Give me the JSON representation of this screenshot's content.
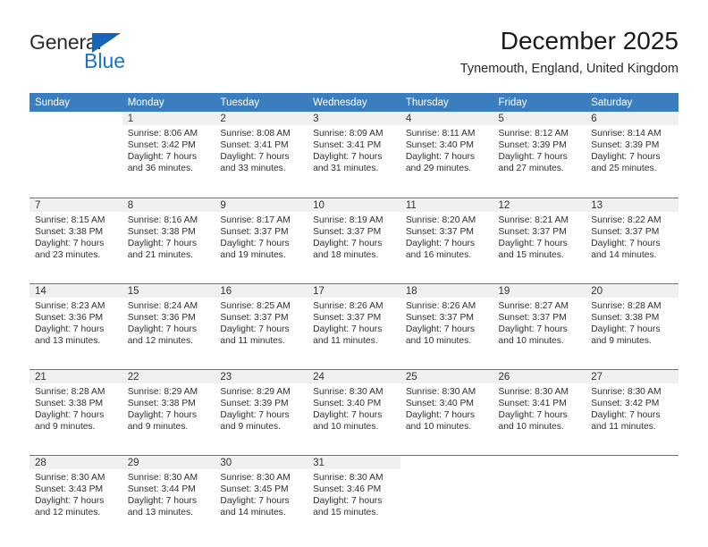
{
  "brand": {
    "name_top": "General",
    "name_bottom": "Blue",
    "accent_color": "#1874c8",
    "triangle_color": "#1565b8"
  },
  "header": {
    "title": "December 2025",
    "subtitle": "Tynemouth, England, United Kingdom"
  },
  "calendar": {
    "header_bg": "#3a7ebf",
    "header_text_color": "#ffffff",
    "daynum_bg": "#f0f0f0",
    "weekdays": [
      "Sunday",
      "Monday",
      "Tuesday",
      "Wednesday",
      "Thursday",
      "Friday",
      "Saturday"
    ],
    "weeks": [
      [
        {
          "day": "",
          "sunrise": "",
          "sunset": "",
          "daylight_line1": "",
          "daylight_line2": ""
        },
        {
          "day": "1",
          "sunrise": "Sunrise: 8:06 AM",
          "sunset": "Sunset: 3:42 PM",
          "daylight_line1": "Daylight: 7 hours",
          "daylight_line2": "and 36 minutes."
        },
        {
          "day": "2",
          "sunrise": "Sunrise: 8:08 AM",
          "sunset": "Sunset: 3:41 PM",
          "daylight_line1": "Daylight: 7 hours",
          "daylight_line2": "and 33 minutes."
        },
        {
          "day": "3",
          "sunrise": "Sunrise: 8:09 AM",
          "sunset": "Sunset: 3:41 PM",
          "daylight_line1": "Daylight: 7 hours",
          "daylight_line2": "and 31 minutes."
        },
        {
          "day": "4",
          "sunrise": "Sunrise: 8:11 AM",
          "sunset": "Sunset: 3:40 PM",
          "daylight_line1": "Daylight: 7 hours",
          "daylight_line2": "and 29 minutes."
        },
        {
          "day": "5",
          "sunrise": "Sunrise: 8:12 AM",
          "sunset": "Sunset: 3:39 PM",
          "daylight_line1": "Daylight: 7 hours",
          "daylight_line2": "and 27 minutes."
        },
        {
          "day": "6",
          "sunrise": "Sunrise: 8:14 AM",
          "sunset": "Sunset: 3:39 PM",
          "daylight_line1": "Daylight: 7 hours",
          "daylight_line2": "and 25 minutes."
        }
      ],
      [
        {
          "day": "7",
          "sunrise": "Sunrise: 8:15 AM",
          "sunset": "Sunset: 3:38 PM",
          "daylight_line1": "Daylight: 7 hours",
          "daylight_line2": "and 23 minutes."
        },
        {
          "day": "8",
          "sunrise": "Sunrise: 8:16 AM",
          "sunset": "Sunset: 3:38 PM",
          "daylight_line1": "Daylight: 7 hours",
          "daylight_line2": "and 21 minutes."
        },
        {
          "day": "9",
          "sunrise": "Sunrise: 8:17 AM",
          "sunset": "Sunset: 3:37 PM",
          "daylight_line1": "Daylight: 7 hours",
          "daylight_line2": "and 19 minutes."
        },
        {
          "day": "10",
          "sunrise": "Sunrise: 8:19 AM",
          "sunset": "Sunset: 3:37 PM",
          "daylight_line1": "Daylight: 7 hours",
          "daylight_line2": "and 18 minutes."
        },
        {
          "day": "11",
          "sunrise": "Sunrise: 8:20 AM",
          "sunset": "Sunset: 3:37 PM",
          "daylight_line1": "Daylight: 7 hours",
          "daylight_line2": "and 16 minutes."
        },
        {
          "day": "12",
          "sunrise": "Sunrise: 8:21 AM",
          "sunset": "Sunset: 3:37 PM",
          "daylight_line1": "Daylight: 7 hours",
          "daylight_line2": "and 15 minutes."
        },
        {
          "day": "13",
          "sunrise": "Sunrise: 8:22 AM",
          "sunset": "Sunset: 3:37 PM",
          "daylight_line1": "Daylight: 7 hours",
          "daylight_line2": "and 14 minutes."
        }
      ],
      [
        {
          "day": "14",
          "sunrise": "Sunrise: 8:23 AM",
          "sunset": "Sunset: 3:36 PM",
          "daylight_line1": "Daylight: 7 hours",
          "daylight_line2": "and 13 minutes."
        },
        {
          "day": "15",
          "sunrise": "Sunrise: 8:24 AM",
          "sunset": "Sunset: 3:36 PM",
          "daylight_line1": "Daylight: 7 hours",
          "daylight_line2": "and 12 minutes."
        },
        {
          "day": "16",
          "sunrise": "Sunrise: 8:25 AM",
          "sunset": "Sunset: 3:37 PM",
          "daylight_line1": "Daylight: 7 hours",
          "daylight_line2": "and 11 minutes."
        },
        {
          "day": "17",
          "sunrise": "Sunrise: 8:26 AM",
          "sunset": "Sunset: 3:37 PM",
          "daylight_line1": "Daylight: 7 hours",
          "daylight_line2": "and 11 minutes."
        },
        {
          "day": "18",
          "sunrise": "Sunrise: 8:26 AM",
          "sunset": "Sunset: 3:37 PM",
          "daylight_line1": "Daylight: 7 hours",
          "daylight_line2": "and 10 minutes."
        },
        {
          "day": "19",
          "sunrise": "Sunrise: 8:27 AM",
          "sunset": "Sunset: 3:37 PM",
          "daylight_line1": "Daylight: 7 hours",
          "daylight_line2": "and 10 minutes."
        },
        {
          "day": "20",
          "sunrise": "Sunrise: 8:28 AM",
          "sunset": "Sunset: 3:38 PM",
          "daylight_line1": "Daylight: 7 hours",
          "daylight_line2": "and 9 minutes."
        }
      ],
      [
        {
          "day": "21",
          "sunrise": "Sunrise: 8:28 AM",
          "sunset": "Sunset: 3:38 PM",
          "daylight_line1": "Daylight: 7 hours",
          "daylight_line2": "and 9 minutes."
        },
        {
          "day": "22",
          "sunrise": "Sunrise: 8:29 AM",
          "sunset": "Sunset: 3:38 PM",
          "daylight_line1": "Daylight: 7 hours",
          "daylight_line2": "and 9 minutes."
        },
        {
          "day": "23",
          "sunrise": "Sunrise: 8:29 AM",
          "sunset": "Sunset: 3:39 PM",
          "daylight_line1": "Daylight: 7 hours",
          "daylight_line2": "and 9 minutes."
        },
        {
          "day": "24",
          "sunrise": "Sunrise: 8:30 AM",
          "sunset": "Sunset: 3:40 PM",
          "daylight_line1": "Daylight: 7 hours",
          "daylight_line2": "and 10 minutes."
        },
        {
          "day": "25",
          "sunrise": "Sunrise: 8:30 AM",
          "sunset": "Sunset: 3:40 PM",
          "daylight_line1": "Daylight: 7 hours",
          "daylight_line2": "and 10 minutes."
        },
        {
          "day": "26",
          "sunrise": "Sunrise: 8:30 AM",
          "sunset": "Sunset: 3:41 PM",
          "daylight_line1": "Daylight: 7 hours",
          "daylight_line2": "and 10 minutes."
        },
        {
          "day": "27",
          "sunrise": "Sunrise: 8:30 AM",
          "sunset": "Sunset: 3:42 PM",
          "daylight_line1": "Daylight: 7 hours",
          "daylight_line2": "and 11 minutes."
        }
      ],
      [
        {
          "day": "28",
          "sunrise": "Sunrise: 8:30 AM",
          "sunset": "Sunset: 3:43 PM",
          "daylight_line1": "Daylight: 7 hours",
          "daylight_line2": "and 12 minutes."
        },
        {
          "day": "29",
          "sunrise": "Sunrise: 8:30 AM",
          "sunset": "Sunset: 3:44 PM",
          "daylight_line1": "Daylight: 7 hours",
          "daylight_line2": "and 13 minutes."
        },
        {
          "day": "30",
          "sunrise": "Sunrise: 8:30 AM",
          "sunset": "Sunset: 3:45 PM",
          "daylight_line1": "Daylight: 7 hours",
          "daylight_line2": "and 14 minutes."
        },
        {
          "day": "31",
          "sunrise": "Sunrise: 8:30 AM",
          "sunset": "Sunset: 3:46 PM",
          "daylight_line1": "Daylight: 7 hours",
          "daylight_line2": "and 15 minutes."
        },
        {
          "day": "",
          "sunrise": "",
          "sunset": "",
          "daylight_line1": "",
          "daylight_line2": ""
        },
        {
          "day": "",
          "sunrise": "",
          "sunset": "",
          "daylight_line1": "",
          "daylight_line2": ""
        },
        {
          "day": "",
          "sunrise": "",
          "sunset": "",
          "daylight_line1": "",
          "daylight_line2": ""
        }
      ]
    ]
  }
}
